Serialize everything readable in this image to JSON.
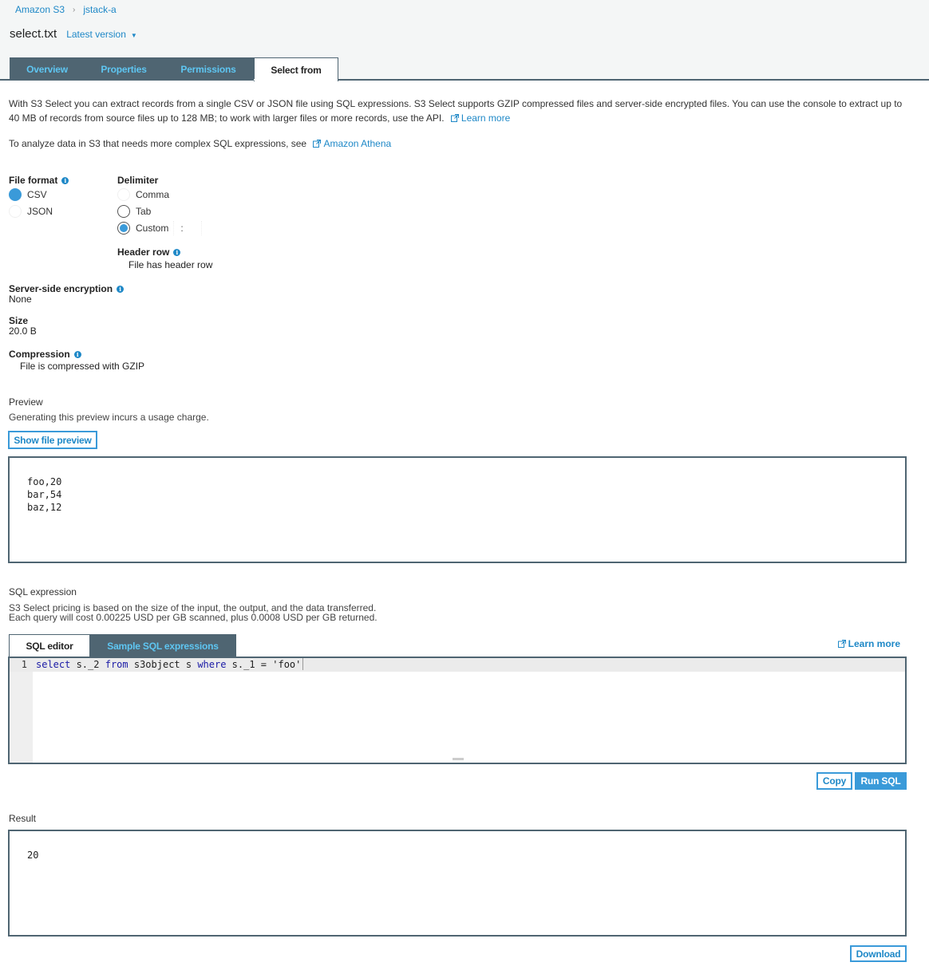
{
  "breadcrumb": [
    "Amazon S3",
    "jstack-a"
  ],
  "file": {
    "title": "select.txt",
    "version_label": "Latest version"
  },
  "tabs": [
    {
      "label": "Overview",
      "active": false
    },
    {
      "label": "Properties",
      "active": false
    },
    {
      "label": "Permissions",
      "active": false
    },
    {
      "label": "Select from",
      "active": true
    }
  ],
  "intro": {
    "text": "With S3 Select you can extract records from a single CSV or JSON file using SQL expressions. S3 Select supports GZIP compressed files and server-side encrypted files. You can use the console to extract up to 40 MB of records from source files up to 128 MB; to work with larger files or more records, use the API.",
    "learn_more": "Learn more",
    "athena_text": "To analyze data in S3 that needs more complex SQL expressions, see",
    "athena_link": "Amazon Athena"
  },
  "file_format": {
    "label": "File format",
    "options": [
      "CSV",
      "JSON"
    ],
    "selected": "CSV"
  },
  "delimiter": {
    "label": "Delimiter",
    "options": [
      "Comma",
      "Tab",
      "Custom"
    ],
    "selected": "Custom",
    "custom_value": ":"
  },
  "header_row": {
    "label": "Header row",
    "checkbox_label": "File has header row"
  },
  "encryption": {
    "label": "Server-side encryption",
    "value": "None"
  },
  "size": {
    "label": "Size",
    "value": "20.0 B"
  },
  "compression": {
    "label": "Compression",
    "checkbox_label": "File is compressed with GZIP"
  },
  "preview": {
    "label": "Preview",
    "description": "Generating this preview incurs a usage charge.",
    "button": "Show file preview",
    "content": "foo,20\nbar,54\nbaz,12"
  },
  "sql": {
    "label": "SQL expression",
    "pricing_line1": "S3 Select pricing is based on the size of the input, the output, and the data transferred.",
    "pricing_line2": "Each query will cost 0.00225 USD per GB scanned, plus 0.0008 USD per GB returned.",
    "tabs": [
      "SQL editor",
      "Sample SQL expressions"
    ],
    "learn_more": "Learn more",
    "line_number": "1",
    "code": {
      "kw_select": "select",
      "part1": " s._2 ",
      "kw_from": "from",
      "part2": " s3object s ",
      "kw_where": "where",
      "part3": " s._1 = ",
      "literal": "'foo'"
    },
    "copy_button": "Copy",
    "run_button": "Run SQL"
  },
  "result": {
    "label": "Result",
    "content": "20",
    "download_button": "Download"
  }
}
